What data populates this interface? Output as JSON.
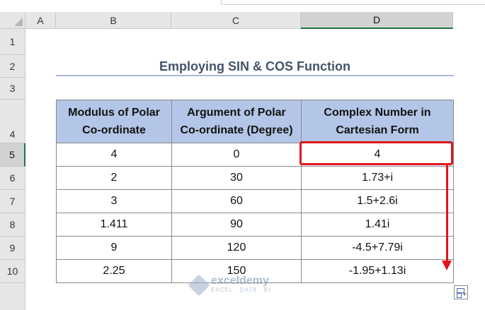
{
  "columns": [
    "A",
    "B",
    "C",
    "D"
  ],
  "rows": [
    "1",
    "2",
    "3",
    "4",
    "5",
    "6",
    "7",
    "8",
    "9",
    "10"
  ],
  "title": "Employing SIN & COS Function",
  "table": {
    "headers": [
      {
        "line1": "Modulus of Polar",
        "line2": "Co-ordinate"
      },
      {
        "line1": "Argument of Polar",
        "line2": "Co-ordinate (Degree)"
      },
      {
        "line1": "Complex Number in",
        "line2": "Cartesian Form"
      }
    ],
    "rows": [
      [
        "4",
        "0",
        "4"
      ],
      [
        "2",
        "30",
        "1.73+i"
      ],
      [
        "3",
        "60",
        "1.5+2.6i"
      ],
      [
        "1.411",
        "90",
        "1.41i"
      ],
      [
        "9",
        "120",
        "-4.5+7.79i"
      ],
      [
        "2.25",
        "150",
        "-1.95+1.13i"
      ]
    ]
  },
  "watermark": {
    "name": "exceldemy",
    "tag": "EXCEL · DATA · BI"
  },
  "colors": {
    "accent": "#e0151c",
    "header_fill": "#b4c6e7",
    "title": "#44546a"
  }
}
